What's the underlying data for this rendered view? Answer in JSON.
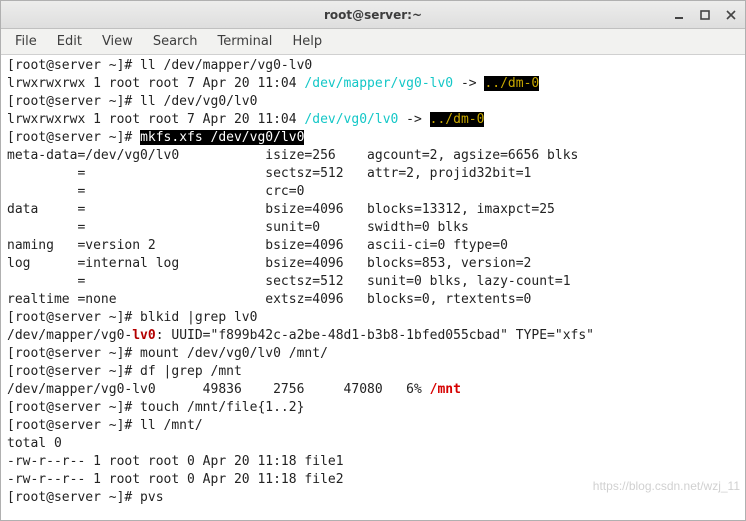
{
  "titlebar": {
    "title": "root@server:~"
  },
  "menu": {
    "file": "File",
    "edit": "Edit",
    "view": "View",
    "search": "Search",
    "terminal": "Terminal",
    "help": "Help"
  },
  "t": {
    "p1": "[root@server ~]# ll /dev/mapper/vg0-lv0",
    "l1a": "lrwxrwxrwx 1 root root 7 Apr 20 11:04 ",
    "l1b": "/dev/mapper/vg0-lv0",
    "l1c": " -> ",
    "l1d": "../dm-0",
    "p2": "[root@server ~]# ll /dev/vg0/lv0",
    "l2a": "lrwxrwxrwx 1 root root 7 Apr 20 11:04 ",
    "l2b": "/dev/vg0/lv0",
    "l2c": " -> ",
    "l2d": "../dm-0",
    "p3a": "[root@server ~]# ",
    "p3b": "mkfs.xfs /dev/vg0/lv0",
    "m1": "meta-data=/dev/vg0/lv0           isize=256    agcount=2, agsize=6656 blks",
    "m2": "         =                       sectsz=512   attr=2, projid32bit=1",
    "m3": "         =                       crc=0",
    "m4": "data     =                       bsize=4096   blocks=13312, imaxpct=25",
    "m5": "         =                       sunit=0      swidth=0 blks",
    "m6": "naming   =version 2              bsize=4096   ascii-ci=0 ftype=0",
    "m7": "log      =internal log           bsize=4096   blocks=853, version=2",
    "m8": "         =                       sectsz=512   sunit=0 blks, lazy-count=1",
    "m9": "realtime =none                   extsz=4096   blocks=0, rtextents=0",
    "p4": "[root@server ~]# blkid |grep lv0",
    "b1a": "/dev/mapper/vg0-",
    "b1b": "lv0",
    "b1c": ": UUID=\"f899b42c-a2be-48d1-b3b8-1bfed055cbad\" TYPE=\"xfs\"",
    "p5": "[root@server ~]# mount /dev/vg0/lv0 /mnt/",
    "p6": "[root@server ~]# df |grep /mnt",
    "d1a": "/dev/mapper/vg0-lv0      49836    2756     47080   6% ",
    "d1b": "/mnt",
    "p7": "[root@server ~]# touch /mnt/file{1..2}",
    "p8": "[root@server ~]# ll /mnt/",
    "tot": "total 0",
    "f1": "-rw-r--r-- 1 root root 0 Apr 20 11:18 file1",
    "f2": "-rw-r--r-- 1 root root 0 Apr 20 11:18 file2",
    "p9": "[root@server ~]# pvs"
  },
  "watermark": "https://blog.csdn.net/wzj_11"
}
